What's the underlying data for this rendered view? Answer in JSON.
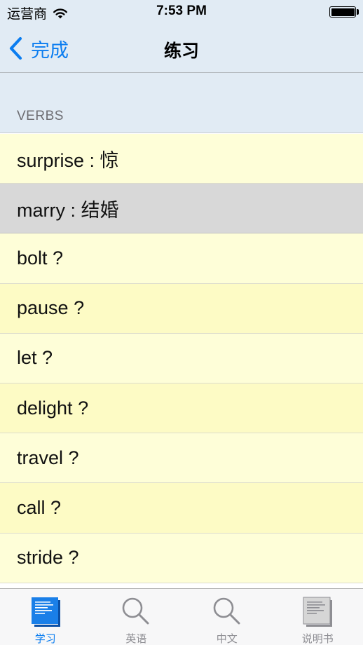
{
  "status_bar": {
    "carrier": "运营商",
    "time": "7:53 PM"
  },
  "nav": {
    "back_label": "完成",
    "title": "练习"
  },
  "section": {
    "title": "VERBS"
  },
  "rows": [
    {
      "text": "surprise : 惊",
      "shade": "light"
    },
    {
      "text": "marry : 结婚",
      "shade": "selected"
    },
    {
      "text": "bolt ?",
      "shade": "light"
    },
    {
      "text": "pause ?",
      "shade": "dark"
    },
    {
      "text": "let ?",
      "shade": "light"
    },
    {
      "text": "delight ?",
      "shade": "dark"
    },
    {
      "text": "travel ?",
      "shade": "light"
    },
    {
      "text": "call ?",
      "shade": "dark"
    },
    {
      "text": "stride ?",
      "shade": "light"
    }
  ],
  "tabs": [
    {
      "label": "学习",
      "icon": "study-card-icon",
      "active": true
    },
    {
      "label": "英语",
      "icon": "magnifier-icon",
      "active": false
    },
    {
      "label": "中文",
      "icon": "magnifier-icon",
      "active": false
    },
    {
      "label": "说明书",
      "icon": "manual-icon",
      "active": false
    }
  ],
  "colors": {
    "accent": "#0b7df0",
    "header_bg": "#e1ebf4",
    "row_light": "#fefed8",
    "row_dark": "#fdfbc5",
    "row_selected": "#d8d8d8"
  }
}
